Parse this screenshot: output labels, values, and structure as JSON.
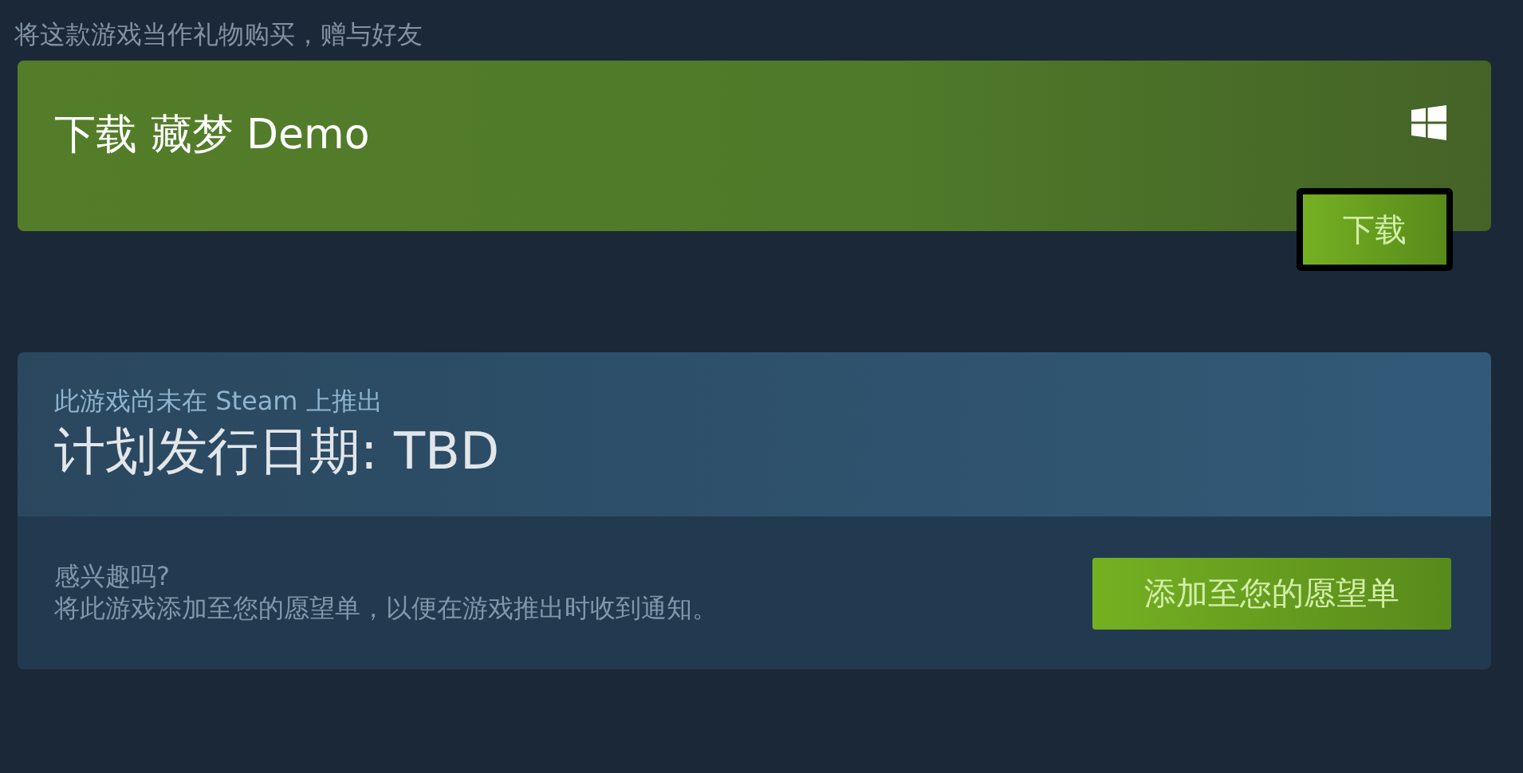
{
  "gift_link": "将这款游戏当作礼物购买，赠与好友",
  "demo": {
    "title": "下载 藏梦 Demo",
    "button": "下载"
  },
  "release": {
    "notice": "此游戏尚未在 Steam 上推出",
    "date": "计划发行日期: TBD",
    "prompt": "感兴趣吗?",
    "description": "将此游戏添加至您的愿望单，以便在游戏推出时收到通知。",
    "button": "添加至您的愿望单"
  }
}
